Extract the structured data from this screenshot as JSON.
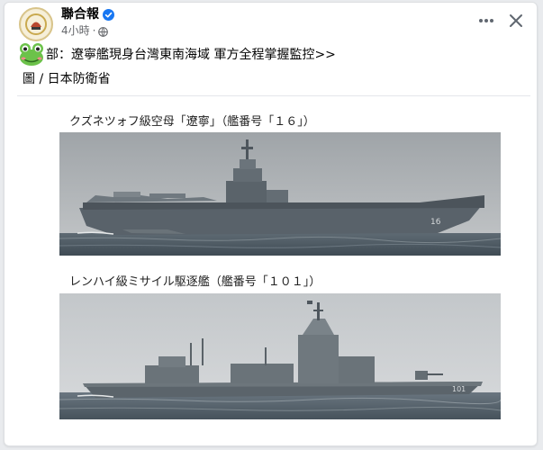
{
  "header": {
    "author": "聯合報",
    "time": "4小時",
    "separator": "·"
  },
  "post": {
    "line1": "部：遼寧艦現身台灣東南海域 軍方全程掌握監控>>",
    "line2": "圖 / 日本防衛省"
  },
  "images": {
    "caption1": "クズネツォフ級空母「遼寧」（艦番号「１６」）",
    "caption2": "レンハイ級ミサイル駆逐艦（艦番号「１０１」）",
    "hull_number": "101"
  },
  "icons": {
    "verified": "verified-badge-icon",
    "globe": "globe-icon",
    "more": "more-options-icon",
    "close": "close-icon",
    "emoji": "frog-emoji-icon"
  },
  "colors": {
    "verified": "#1877f2",
    "meta_text": "#65676b"
  }
}
